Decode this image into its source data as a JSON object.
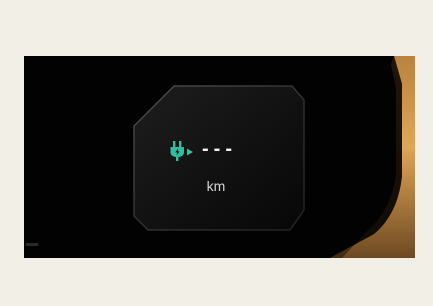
{
  "display": {
    "range_value": "---",
    "range_unit": "km",
    "icon": "charging-plug-icon"
  },
  "colors": {
    "page_background": "#f2efe6",
    "screen_background": "#020202",
    "icon_accent": "#2fc0a0",
    "accent_trim": "#c88a3c"
  }
}
